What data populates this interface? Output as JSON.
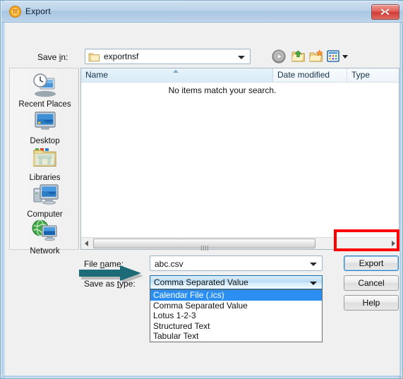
{
  "window": {
    "title": "Export",
    "title_icon": "app-icon",
    "close_label": "Close"
  },
  "toolbar": {
    "save_in_label": "Save in:",
    "save_in_value": "exportnsf",
    "back_icon": "back-arrow-icon",
    "up_icon": "up-one-level-icon",
    "new_folder_icon": "new-folder-icon",
    "views_icon": "views-icon"
  },
  "places": [
    {
      "label": "Recent Places",
      "icon": "recent-places-icon"
    },
    {
      "label": "Desktop",
      "icon": "desktop-icon"
    },
    {
      "label": "Libraries",
      "icon": "libraries-icon"
    },
    {
      "label": "Computer",
      "icon": "computer-icon"
    },
    {
      "label": "Network",
      "icon": "network-icon"
    }
  ],
  "filelist": {
    "columns": [
      "Name",
      "Date modified",
      "Type"
    ],
    "sort_column": "Name",
    "sort_direction": "ascending",
    "empty_message": "No items match your search.",
    "rows": []
  },
  "form": {
    "filename_label_pre": "File ",
    "filename_label_key": "n",
    "filename_label_post": "ame:",
    "filename_value": "abc.csv",
    "filename_placeholder": "",
    "savetype_label_pre": "Save as ",
    "savetype_label_key": "t",
    "savetype_label_post": "ype:",
    "savetype_value": "Comma Separated Value",
    "savetype_options": [
      "Calendar File (.ics)",
      "Comma Separated Value",
      "Lotus 1-2-3",
      "Structured Text",
      "Tabular Text"
    ],
    "savetype_selected_index": 0
  },
  "buttons": {
    "export": "Export",
    "cancel": "Cancel",
    "help": "Help"
  },
  "annotations": {
    "highlight_color": "#ff0000",
    "arrow_color": "#1d6b77",
    "highlight_target": "Export",
    "arrow_target": "Calendar File (.ics)"
  }
}
